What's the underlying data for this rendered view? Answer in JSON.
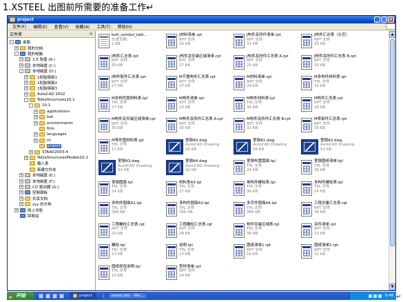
{
  "doc": {
    "heading": "1.XSTEEL 出图前所需要的准备工作↵",
    "para_mark": "↵"
  },
  "window": {
    "title": "project",
    "menu": [
      "文件(F)",
      "编辑(E)",
      "查看(V)",
      "收藏(A)",
      "工具(T)",
      "帮助(H)"
    ],
    "folders_header": "文件夹",
    "close_glyph": "×"
  },
  "tree": [
    {
      "label": "桌面",
      "expander": "-",
      "icon": "sys"
    },
    {
      "label": "我的文档",
      "expander": "+",
      "icon": "folder"
    },
    {
      "label": "我的电脑",
      "expander": "-",
      "icon": "sys"
    },
    {
      "label": "3.5 软盘 (A:)",
      "expander": "+",
      "icon": "drive"
    },
    {
      "label": "本地磁盘 (C:)",
      "expander": "+",
      "icon": "drive"
    },
    {
      "label": "本地磁盘 (D:)",
      "expander": "-",
      "icon": "drive"
    },
    {
      "label": "1轮胎钢架1",
      "expander": "+",
      "icon": "folder"
    },
    {
      "label": "1轮胎钢架2",
      "expander": "+",
      "icon": "folder"
    },
    {
      "label": "1轮胎钢架3",
      "expander": "+",
      "icon": "folder"
    },
    {
      "label": "AutoCAD 2002",
      "expander": "+",
      "icon": "folder"
    },
    {
      "label": "TeklaStructures10.1",
      "expander": "-",
      "icon": "folder"
    },
    {
      "label": "10.1",
      "expander": "-",
      "icon": "folder"
    },
    {
      "label": "applications",
      "expander": "+",
      "icon": "folder"
    },
    {
      "label": "bat",
      "expander": "+",
      "icon": "folder"
    },
    {
      "label": "environments",
      "expander": "+",
      "icon": "folder"
    },
    {
      "label": "firm",
      "expander": "",
      "icon": "folder"
    },
    {
      "label": "languages",
      "expander": "+",
      "icon": "folder"
    },
    {
      "label": "nt",
      "expander": "+",
      "icon": "folder"
    },
    {
      "label": "project",
      "expander": "",
      "icon": "folder",
      "selected": true
    },
    {
      "label": "STAAD2003-4",
      "expander": "+",
      "icon": "folder"
    },
    {
      "label": "TeklaStructuresModels10.1",
      "expander": "+",
      "icon": "folder"
    },
    {
      "label": "输入表",
      "expander": "",
      "icon": "folder"
    },
    {
      "label": "新建文件夹",
      "expander": "",
      "icon": "folder"
    },
    {
      "label": "本地磁盘 (E:)",
      "expander": "+",
      "icon": "drive"
    },
    {
      "label": "本地磁盘 (F:)",
      "expander": "+",
      "icon": "drive"
    },
    {
      "label": "CD 驱动器 (G:)",
      "expander": "+",
      "icon": "drive"
    },
    {
      "label": "控制面板",
      "expander": "+",
      "icon": "sys"
    },
    {
      "label": "共享文档",
      "expander": "+",
      "icon": "folder"
    },
    {
      "label": "zyy 的文档",
      "expander": "+",
      "icon": "folder"
    },
    {
      "label": "网上邻居",
      "expander": "+",
      "icon": "sys"
    },
    {
      "label": "回收站",
      "expander": "",
      "icon": "sys"
    }
  ],
  "files": [
    {
      "name": "bolt_symbol_tabl...",
      "type": "文本文档",
      "size": "2 KB",
      "kind": "txt"
    },
    {
      "name": "J材料清单.rpt",
      "type": "RPT 文件",
      "size": "26 KB",
      "kind": "rpt"
    },
    {
      "name": "J构件及所件清单.rpt",
      "type": "RPT 文件",
      "size": "31 KB",
      "kind": "rpt"
    },
    {
      "name": "J构件汇总表（分页）",
      "type": "RPT 文件",
      "size": "25 KB",
      "kind": "rpt"
    },
    {
      "name": "J构件汇总表.rpt",
      "type": "RPT 文件",
      "size": "30 KB",
      "kind": "rpt"
    },
    {
      "name": "J构件及安装区域清单.rpt",
      "type": "RPT 文件",
      "size": "27 KB",
      "kind": "rpt"
    },
    {
      "name": "J构件及所件汇总表 A.rpt",
      "type": "RPT 文件",
      "size": "25 KB",
      "kind": "rpt"
    },
    {
      "name": "J构件及所件汇总表 B.rpt",
      "type": "RPT 文件",
      "size": "25 KB",
      "kind": "rpt"
    },
    {
      "name": "J构件配件汇总表.rpt",
      "type": "RPT 文件",
      "size": "27 KB",
      "kind": "rpt"
    },
    {
      "name": "M节置构件汇总表.rpt",
      "type": "RPT 文件",
      "size": "27 KB",
      "kind": "rpt"
    },
    {
      "name": "M材料清单.rpt",
      "type": "RPT 文件",
      "size": "29 KB",
      "kind": "rpt"
    },
    {
      "name": "M多构件材料表.tpl",
      "type": "TPL 文件",
      "size": "32 KB",
      "kind": "rpt"
    },
    {
      "name": "M多构件图材料表.tpl",
      "type": "TPL 文件",
      "size": "27 KB",
      "kind": "rpt"
    },
    {
      "name": "M构件清单.rpt",
      "type": "RPT 文件",
      "size": "23 KB",
      "kind": "rpt"
    },
    {
      "name": "M构件材料表.tpl",
      "type": "TPL 文件",
      "size": "36 KB",
      "kind": "rpt"
    },
    {
      "name": "M构件汇总表.rpt",
      "type": "RPT 文件",
      "size": "28 KB",
      "kind": "rpt"
    },
    {
      "name": "M构件及安装区域清单.rpt",
      "type": "RPT 文件",
      "size": "30 KB",
      "kind": "rpt"
    },
    {
      "name": "M构件及所件汇总表 A.rpt",
      "type": "RPT 文件",
      "size": "30 KB",
      "kind": "rpt"
    },
    {
      "name": "M构件及所件汇总表 B.rpt",
      "type": "RPT 文件",
      "size": "31 KB",
      "kind": "rpt"
    },
    {
      "name": "M零部件汇总表.rpt",
      "type": "RPT 文件",
      "size": "35 KB",
      "kind": "rpt"
    },
    {
      "name": "M零件图材料表.tpl",
      "type": "TPL 文件",
      "size": "17 KB",
      "kind": "rpt"
    },
    {
      "name": "室钢A0.dwg",
      "type": "AutoCAD Drawing",
      "size": "45 KB",
      "kind": "dwg"
    },
    {
      "name": "室钢A1.dwg",
      "type": "AutoCAD Drawing",
      "size": "58 KB",
      "kind": "dwg"
    },
    {
      "name": "室钢A2.dwg",
      "type": "AutoCAD Drawing",
      "size": "52 KB",
      "kind": "dwg"
    },
    {
      "name": "室钢A3.dwg",
      "type": "AutoCAD Drawing",
      "size": "54 KB",
      "kind": "dwg"
    },
    {
      "name": "室钢A4.dwg",
      "type": "AutoCAD Drawing",
      "size": "42 KB",
      "kind": "dwg"
    },
    {
      "name": "室钢布置图面.tpl",
      "type": "TPL 文件",
      "size": "24 KB",
      "kind": "rpt"
    },
    {
      "name": "室钢图纸清单.tpl",
      "type": "TPL 文件",
      "size": "36 KB",
      "kind": "rpt"
    },
    {
      "name": "室钢图面.tpl",
      "type": "TPL 文件",
      "size": "24 KB",
      "kind": "rpt"
    },
    {
      "name": "材料表A3.tpl",
      "type": "TPL 文件",
      "size": "17 KB",
      "kind": "rpt"
    },
    {
      "name": "单构件螺栓表.tpl",
      "type": "TPL 文件",
      "size": "36 KB",
      "kind": "rpt"
    },
    {
      "name": "多构件螺栓表.tpl",
      "type": "TPL 文件",
      "size": "14 KB",
      "kind": "rpt"
    },
    {
      "name": "多构件图面A1.tpl",
      "type": "TPL 文件",
      "size": "366 KB",
      "kind": "rpt"
    },
    {
      "name": "多构件图面A3.tpl",
      "type": "TPL 文件",
      "size": "366 KB",
      "kind": "rpt"
    },
    {
      "name": "多页件图面A4.tpl",
      "type": "TPL 文件",
      "size": "366 KB",
      "kind": "rpt"
    },
    {
      "name": "工程总量汇总表.rpt",
      "type": "RPT 文件",
      "size": "26 KB",
      "kind": "rpt"
    },
    {
      "name": "工程螺栓汇总表.rpt",
      "type": "RPT 文件",
      "size": "20 KB",
      "kind": "rpt"
    },
    {
      "name": "工程螺栓汇总表.rpt",
      "type": "RPT 文件",
      "size": "28 KB",
      "kind": "rpt"
    },
    {
      "name": "构件安装区域表.tpl",
      "type": "TPL 文件",
      "size": "36 KB",
      "kind": "rpt"
    },
    {
      "name": "另件清单.rpt",
      "type": "RPT 文件",
      "size": "23 KB",
      "kind": "rpt"
    },
    {
      "name": "螺栓.tpl",
      "type": "TPL 文件",
      "size": "13 KB",
      "kind": "rpt"
    },
    {
      "name": "说明.tpl",
      "type": "TPL 文件",
      "size": "13 KB",
      "kind": "rpt"
    },
    {
      "name": "图纸清单1.rpt",
      "type": "RPT 文件",
      "size": "16 KB",
      "kind": "rpt"
    },
    {
      "name": "图纸清单2.rpt",
      "type": "RPT 文件",
      "size": "32 KB",
      "kind": "rpt"
    },
    {
      "name": "图纸修改说明.tpl",
      "type": "TPL 文件",
      "size": "10 KB",
      "kind": "rpt"
    },
    {
      "name": "型材清单.rpt",
      "type": "RPT 文件",
      "size": "24 KB",
      "kind": "rpt"
    }
  ],
  "taskbar": {
    "start": "开始",
    "tasks": [
      {
        "label": "project",
        "icon": "folder",
        "active": true
      },
      {
        "label": "xsteel.doc - Mic...",
        "icon": "word",
        "active": false
      }
    ],
    "clock": "9:48"
  }
}
